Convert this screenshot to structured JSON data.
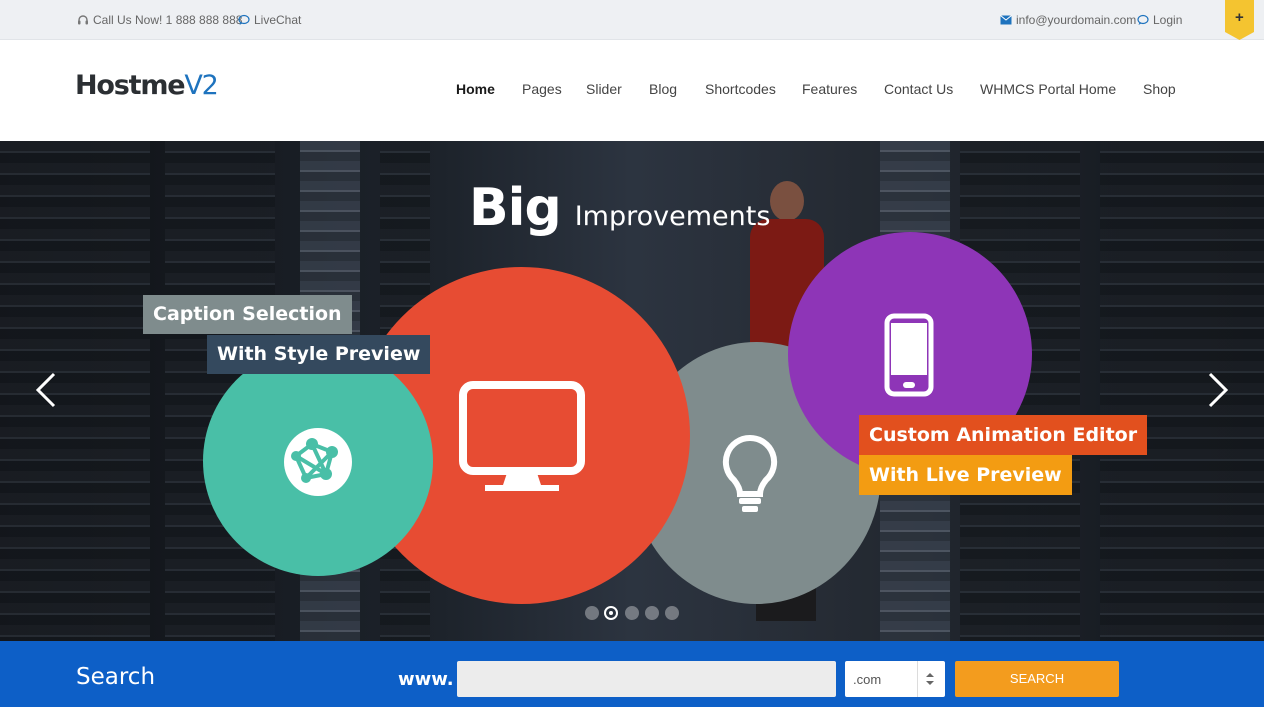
{
  "topbar": {
    "phone_text": "Call Us Now! 1 888 888 888",
    "livechat_label": "LiveChat",
    "email": "info@yourdomain.com",
    "login_label": "Login",
    "plus_label": "+"
  },
  "header": {
    "logo_main": "Hostme",
    "logo_suffix": "V2",
    "nav": [
      {
        "label": "Home",
        "active": true
      },
      {
        "label": "Pages"
      },
      {
        "label": "Slider"
      },
      {
        "label": "Blog"
      },
      {
        "label": "Shortcodes"
      },
      {
        "label": "Features"
      },
      {
        "label": "Contact Us"
      },
      {
        "label": "WHMCS Portal Home"
      },
      {
        "label": "Shop"
      }
    ]
  },
  "hero": {
    "title_big": "Big",
    "title_rest": "Improvements",
    "captions": {
      "caption_selection": "Caption Selection",
      "with_style_preview": "With Style Preview",
      "custom_animation_editor": "Custom Animation Editor",
      "with_live_preview": "With Live Preview"
    },
    "icons": [
      "globe-network-icon",
      "monitor-icon",
      "lightbulb-icon",
      "smartphone-icon"
    ],
    "slides_total": 5,
    "active_slide": 2
  },
  "search": {
    "title": "Search",
    "www_label": "www.",
    "domain_value": "",
    "tld_selected": ".com",
    "button_label": "SEARCH"
  },
  "colors": {
    "brand_blue": "#1e73be",
    "search_bar": "#0d5fc7",
    "search_button": "#f39c1e",
    "teal": "#49bfa7",
    "red": "#e74c33",
    "grey": "#7f8c8d",
    "purple": "#8e35b7",
    "accent_yellow": "#f4c430"
  }
}
